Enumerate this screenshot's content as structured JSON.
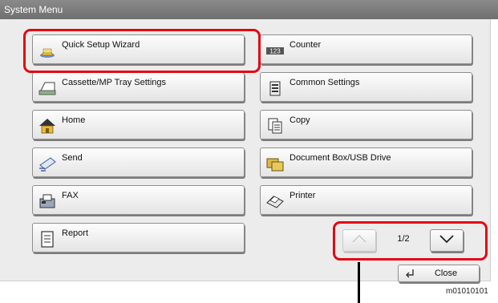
{
  "window": {
    "title": "System Menu"
  },
  "menu_items": [
    {
      "label": "Quick Setup Wizard",
      "icon": "wizard-hat-icon"
    },
    {
      "label": "Counter",
      "icon": "counter-123-icon"
    },
    {
      "label": "Cassette/MP Tray Settings",
      "icon": "paper-tray-icon"
    },
    {
      "label": "Common Settings",
      "icon": "common-settings-icon"
    },
    {
      "label": "Home",
      "icon": "home-icon"
    },
    {
      "label": "Copy",
      "icon": "copy-icon"
    },
    {
      "label": "Send",
      "icon": "send-icon"
    },
    {
      "label": "Document Box/USB Drive",
      "icon": "document-box-icon"
    },
    {
      "label": "FAX",
      "icon": "fax-icon"
    },
    {
      "label": "Printer",
      "icon": "printer-icon"
    },
    {
      "label": "Report",
      "icon": "report-icon"
    }
  ],
  "pagination": {
    "page_label": "1/2",
    "current": 1,
    "total": 2
  },
  "close_button": {
    "label": "Close"
  },
  "figure_code": "m01010101",
  "colors": {
    "highlight": "#e30613",
    "titlebar": "#7a7a7a",
    "panel": "#ececec"
  }
}
